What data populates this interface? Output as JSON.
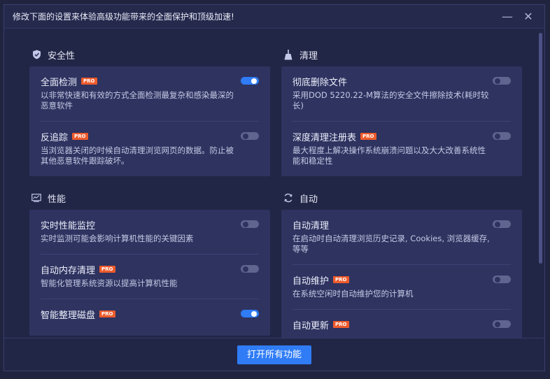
{
  "window": {
    "title": "修改下面的设置来体验高级功能带来的全面保护和顶级加速!",
    "minimize_glyph": "—",
    "close_glyph": "✕"
  },
  "colors": {
    "accent": "#2f7cf6",
    "pro_badge": "#ee5b2c",
    "background": "#222646",
    "card": "#2e3360"
  },
  "sections": {
    "security": {
      "label": "安全性",
      "icon": "shield-icon",
      "items": [
        {
          "title": "全面检测",
          "pro": "PRO",
          "desc": "以非常快速和有效的方式全面检测最复杂和感染最深的恶意软件",
          "enabled": true
        },
        {
          "title": "反追踪",
          "pro": "PRO",
          "desc": "当浏览器关闭的时候自动清理浏览网页的数据。防止被其他恶意软件跟踪破坏。",
          "enabled": false
        }
      ]
    },
    "clean": {
      "label": "清理",
      "icon": "broom-icon",
      "items": [
        {
          "title": "彻底删除文件",
          "desc": "采用DOD 5220.22-M算法的安全文件擦除技术(耗时较长)",
          "enabled": false
        },
        {
          "title": "深度清理注册表",
          "pro": "PRO",
          "desc": "最大程度上解决操作系统崩溃问题以及大大改善系统性能和稳定性",
          "enabled": false
        }
      ]
    },
    "performance": {
      "label": "性能",
      "icon": "monitor-chart-icon",
      "items": [
        {
          "title": "实时性能监控",
          "desc": "实时监测可能会影响计算机性能的关键因素",
          "enabled": false
        },
        {
          "title": "自动内存清理",
          "pro": "PRO",
          "desc": "智能化管理系统资源以提高计算机性能",
          "enabled": false
        },
        {
          "title": "智能整理磁盘",
          "pro": "PRO",
          "desc": "",
          "enabled": true
        }
      ]
    },
    "auto": {
      "label": "自动",
      "icon": "refresh-icon",
      "items": [
        {
          "title": "自动清理",
          "desc": "在启动时自动清理浏览历史记录, Cookies, 浏览器缓存, 等等",
          "enabled": false
        },
        {
          "title": "自动维护",
          "pro": "PRO",
          "desc": "在系统空闲时自动维护您的计算机",
          "enabled": false
        },
        {
          "title": "自动更新",
          "pro": "PRO",
          "desc": "",
          "enabled": false
        }
      ]
    }
  },
  "footer": {
    "primary_label": "打开所有功能"
  }
}
